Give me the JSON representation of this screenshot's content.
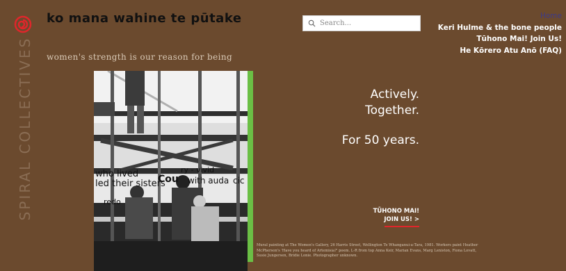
{
  "brand": {
    "vertical_name": "SPIRAL COLLECTIVES",
    "site_title": "ko mana wahine te pūtake",
    "tagline": "women's strength is our reason for being",
    "logo_icon": "spiral-icon",
    "logo_color": "#e0262b"
  },
  "search": {
    "placeholder": "Search...",
    "value": "",
    "icon": "search-icon"
  },
  "nav": {
    "items": [
      {
        "label": "Home",
        "active": true
      },
      {
        "label": "Keri Hulme & the bone people"
      },
      {
        "label": "Tūhono Mai! Join Us!"
      },
      {
        "label": "He Kōrero Atu Anō (FAQ)"
      }
    ],
    "active_color": "#3c3a8a"
  },
  "hero": {
    "line1": "Actively.",
    "line2": "Together.",
    "line3": "For 50 years.",
    "cta_line1": "TŪHONO MAI!",
    "cta_line2": "JOIN US! >",
    "cta_underline_color": "#e0262b",
    "accent_bar_color": "#6bbf45",
    "background_color": "#6b4a2e"
  },
  "photo": {
    "mural_text_1": "who lived",
    "mural_text_2": "led their sisters",
    "mural_text_3": "Cou",
    "mural_text_4": "ry - vivid",
    "mural_text_5": "with auda",
    "mural_text_6": "cic",
    "mural_text_7": "redo"
  },
  "caption": {
    "text": "Mural painting at The Women's Gallery, 26 Harris Street, Wellington Te Whanganui-a-Tara, 1981. Workers paint Heather McPherson's 'Have you heard of Artemisia?' poem. L-R from top Anna Keir, Marian Evans, Marg Leniston, Fiona Lovatt, Susie Jungersen, Bridie Lonie. Photographer unknown."
  }
}
